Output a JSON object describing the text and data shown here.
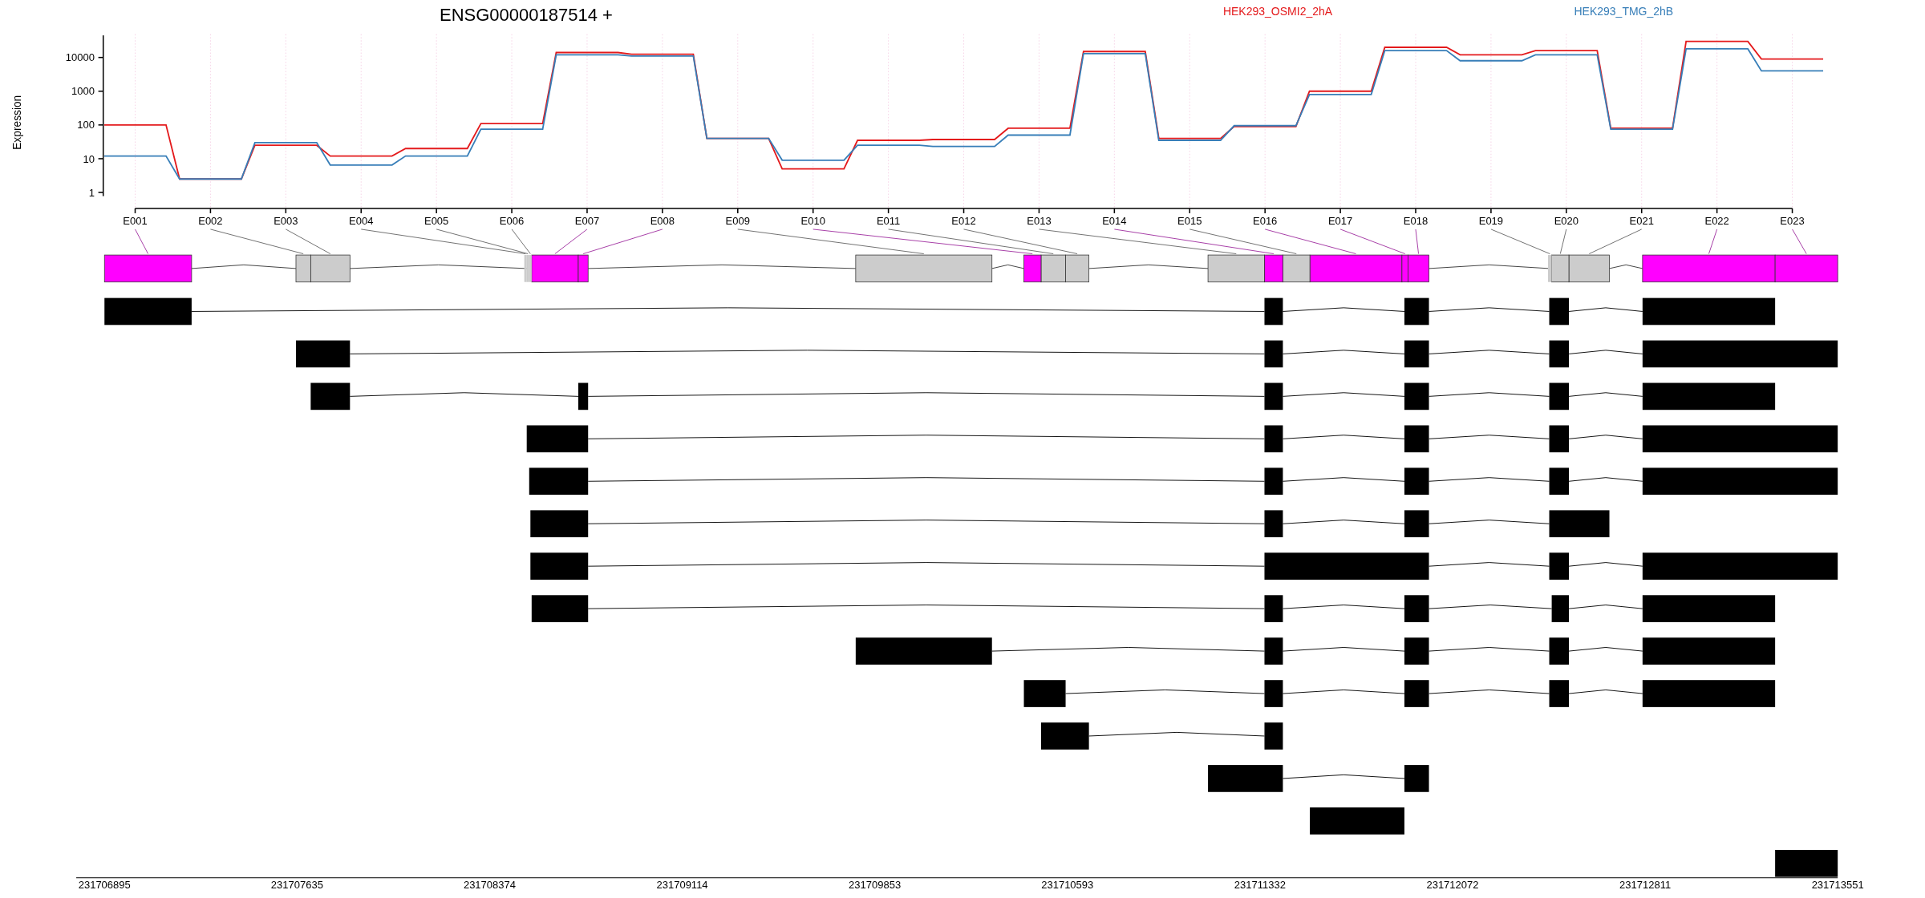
{
  "title": "ENSG00000187514 +",
  "legend": [
    {
      "label": "HEK293_OSMI2_2hA",
      "color": "#e41a1c"
    },
    {
      "label": "HEK293_TMG_2hB",
      "color": "#377eb8"
    }
  ],
  "y_axis": {
    "title": "Expression",
    "ticks": [
      "10000",
      "1000",
      "100",
      "10",
      "1"
    ]
  },
  "exon_labels": [
    "E001",
    "E002",
    "E003",
    "E004",
    "E005",
    "E006",
    "E007",
    "E008",
    "E009",
    "E010",
    "E011",
    "E012",
    "E013",
    "E014",
    "E015",
    "E016",
    "E017",
    "E018",
    "E019",
    "E020",
    "E021",
    "E022",
    "E023"
  ],
  "gene_model": {
    "exons": [
      {
        "color": "#ff00ff"
      },
      {
        "color": "#cccccc"
      },
      {
        "color": "#cccccc"
      },
      {
        "color": "#cccccc"
      },
      {
        "color": "#cccccc"
      },
      {
        "color": "#cccccc"
      },
      {
        "color": "#ff00ff"
      },
      {
        "color": "#ff00ff"
      },
      {
        "color": "#cccccc"
      },
      {
        "color": "#ff00ff"
      },
      {
        "color": "#cccccc"
      },
      {
        "color": "#cccccc"
      },
      {
        "color": "#cccccc"
      },
      {
        "color": "#ff00ff"
      },
      {
        "color": "#cccccc"
      },
      {
        "color": "#ff00ff"
      },
      {
        "color": "#ff00ff"
      },
      {
        "color": "#ff00ff"
      },
      {
        "color": "#cccccc"
      },
      {
        "color": "#cccccc"
      },
      {
        "color": "#cccccc"
      },
      {
        "color": "#ff00ff"
      },
      {
        "color": "#ff00ff"
      }
    ]
  },
  "genomic_axis": {
    "ticks": [
      "231706895",
      "231707635",
      "231708374",
      "231709114",
      "231709853",
      "231710593",
      "231711332",
      "231712072",
      "231712811",
      "231713551"
    ]
  }
}
